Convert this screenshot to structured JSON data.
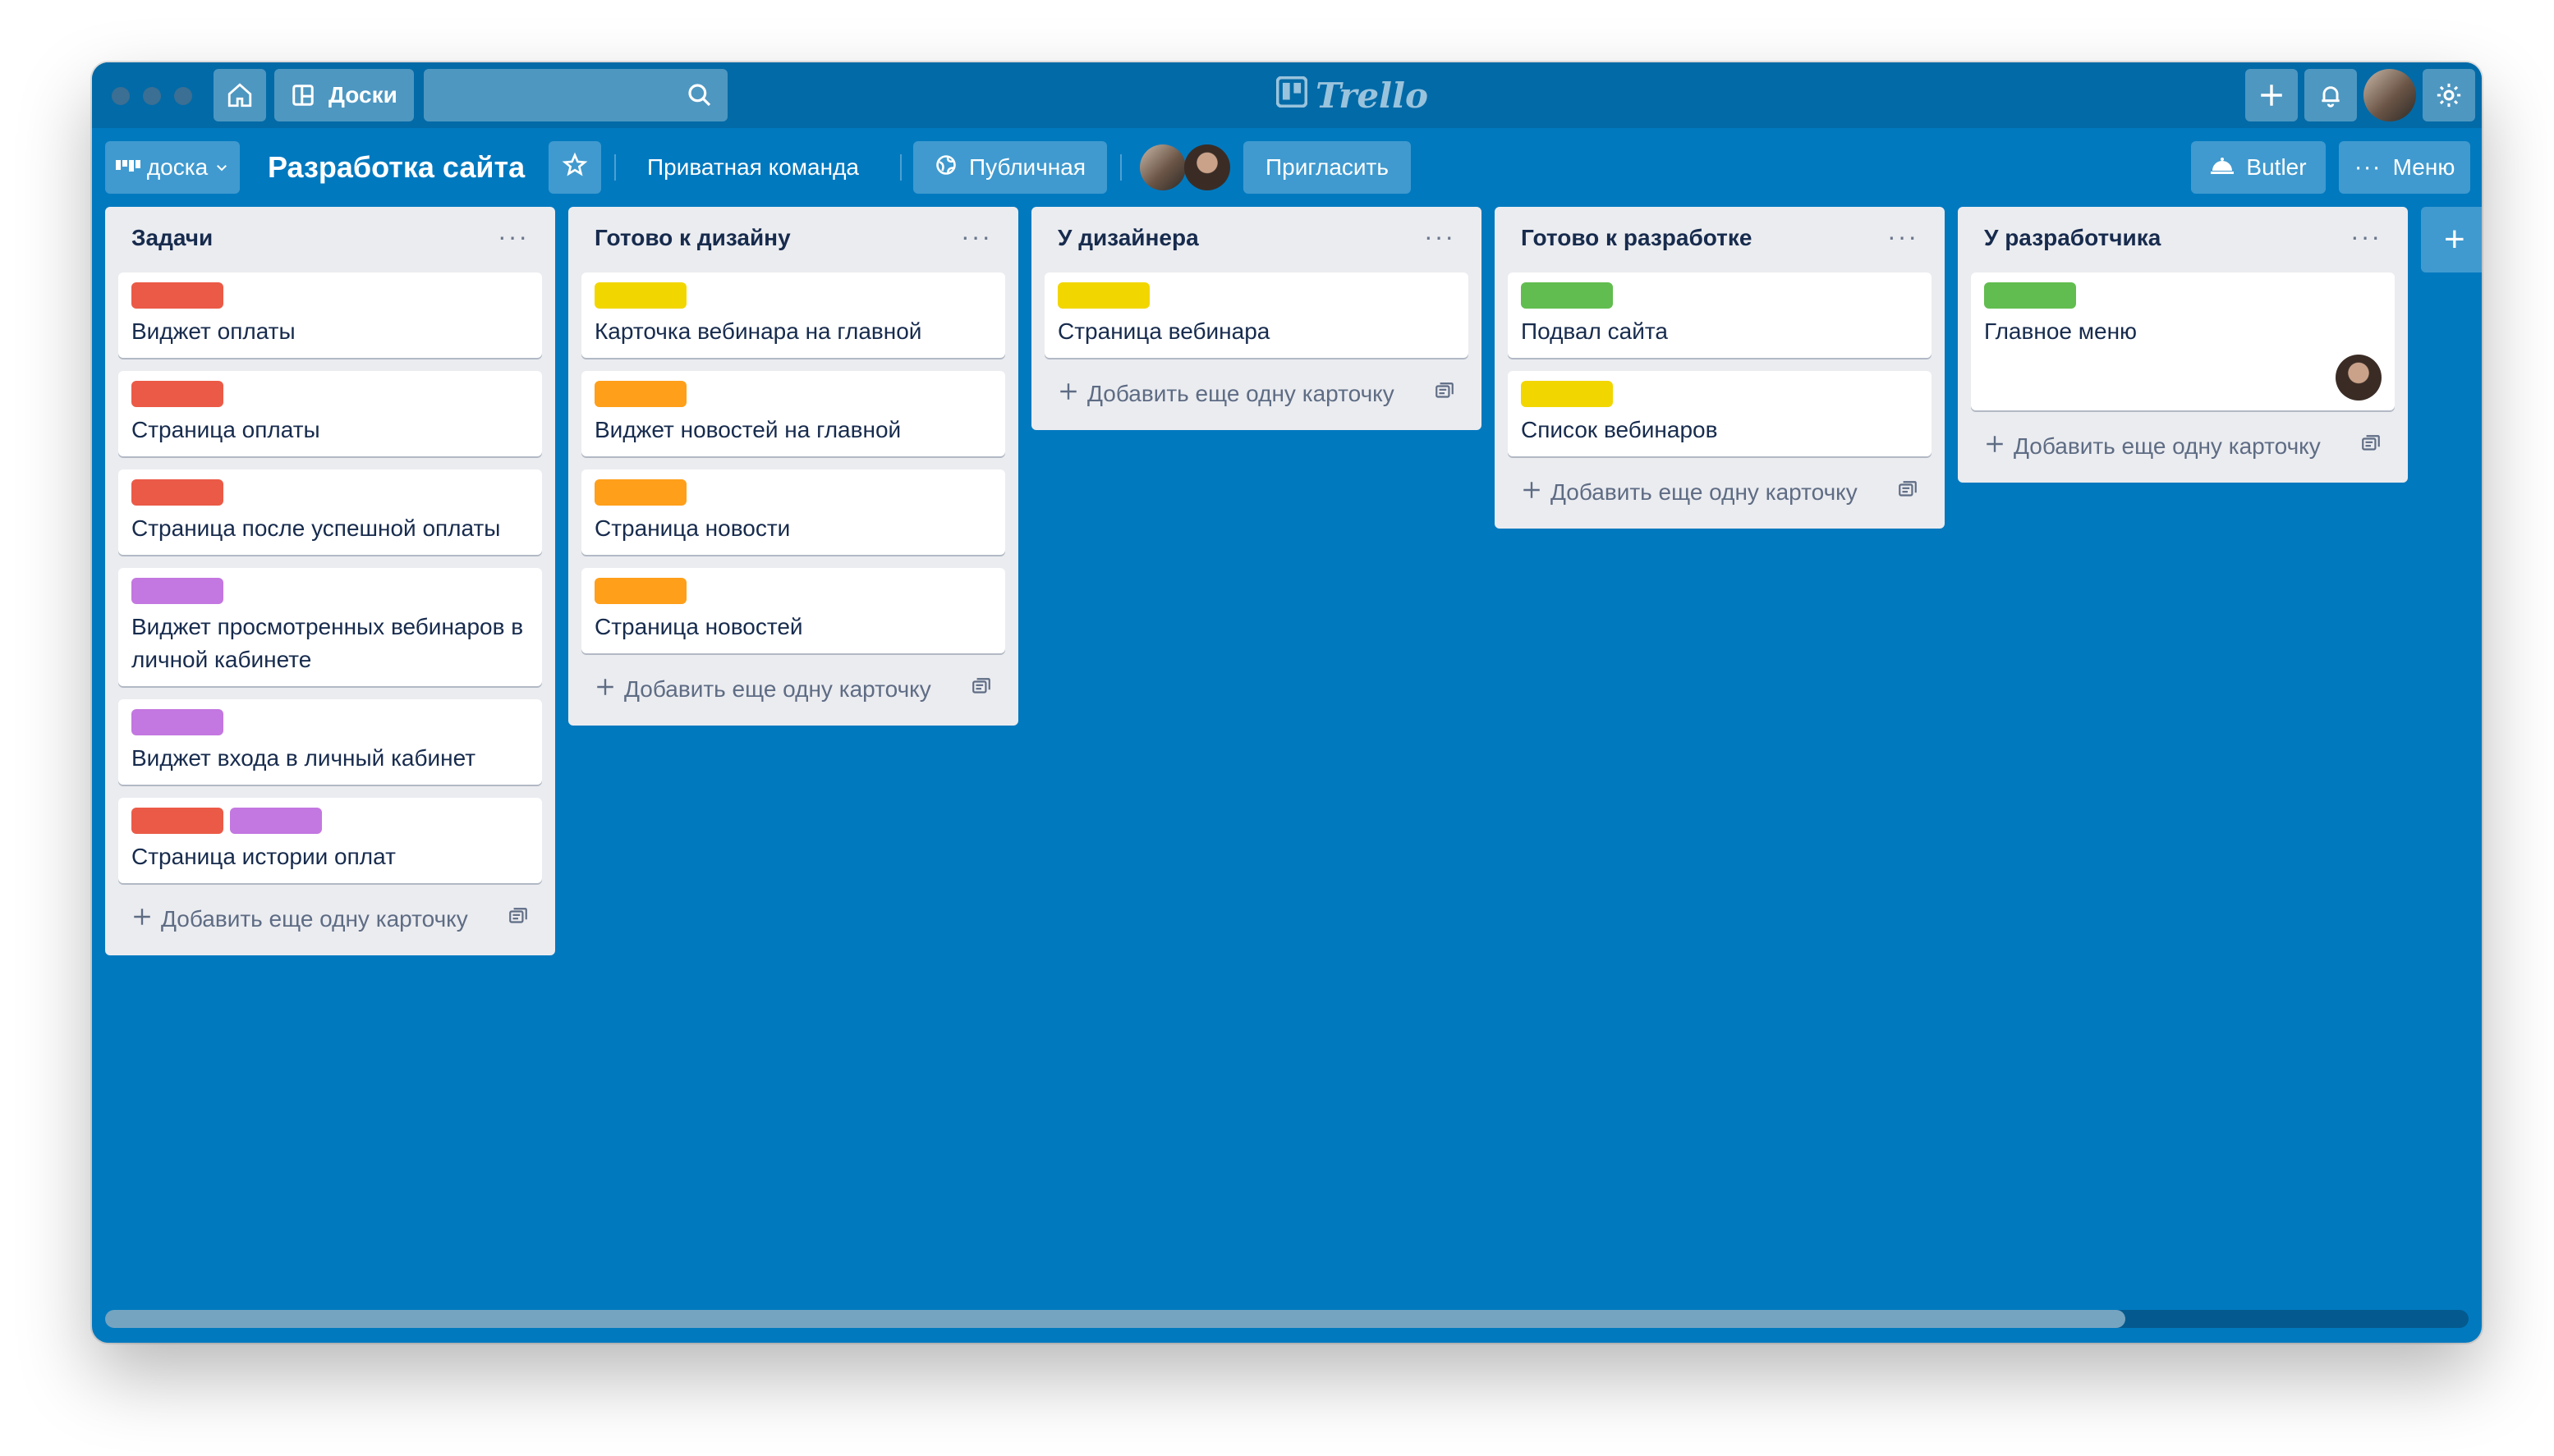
{
  "header": {
    "boards_label": "Доски",
    "logo_text": "Trello"
  },
  "board": {
    "view_label": "доска",
    "title": "Разработка сайта",
    "team": "Приватная команда",
    "visibility": "Публичная",
    "invite_label": "Пригласить",
    "butler_label": "Butler",
    "menu_label": "Меню"
  },
  "add_card_label": "Добавить еще одну карточку",
  "colors": {
    "board_bg": "#0079bf",
    "red": "#eb5a46",
    "yellow": "#f2d600",
    "orange": "#ff9f1a",
    "green": "#61bd4f",
    "purple": "#c377e0"
  },
  "lists": [
    {
      "title": "Задачи",
      "cards": [
        {
          "title": "Виджет оплаты",
          "labels": [
            "red"
          ]
        },
        {
          "title": "Страница оплаты",
          "labels": [
            "red"
          ]
        },
        {
          "title": "Страница после успешной оплаты",
          "labels": [
            "red"
          ]
        },
        {
          "title": "Виджет просмотренных вебинаров в личной кабинете",
          "labels": [
            "purple"
          ]
        },
        {
          "title": "Виджет входа в личный кабинет",
          "labels": [
            "purple"
          ]
        },
        {
          "title": "Страница истории оплат",
          "labels": [
            "red",
            "purple"
          ]
        }
      ]
    },
    {
      "title": "Готово к дизайну",
      "cards": [
        {
          "title": "Карточка вебинара на главной",
          "labels": [
            "yellow"
          ]
        },
        {
          "title": "Виджет новостей на главной",
          "labels": [
            "orange"
          ]
        },
        {
          "title": "Страница новости",
          "labels": [
            "orange"
          ]
        },
        {
          "title": "Страница новостей",
          "labels": [
            "orange"
          ]
        }
      ]
    },
    {
      "title": "У дизайнера",
      "cards": [
        {
          "title": "Страница вебинара",
          "labels": [
            "yellow"
          ]
        }
      ]
    },
    {
      "title": "Готово к разработке",
      "cards": [
        {
          "title": "Подвал сайта",
          "labels": [
            "green"
          ]
        },
        {
          "title": "Список вебинаров",
          "labels": [
            "yellow"
          ]
        }
      ]
    },
    {
      "title": "У разработчика",
      "cards": [
        {
          "title": "Главное меню",
          "labels": [
            "green"
          ],
          "member": "developer-avatar"
        }
      ]
    }
  ]
}
